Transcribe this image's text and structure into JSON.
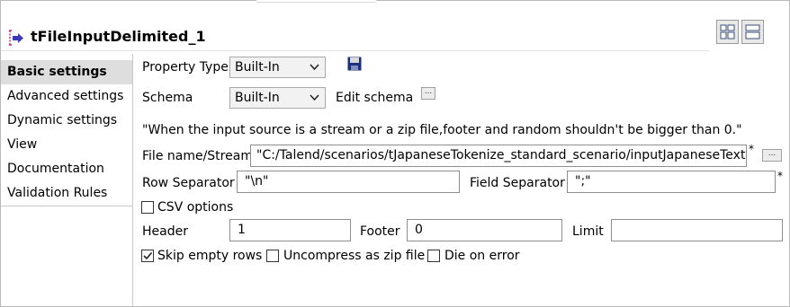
{
  "component": {
    "title": "tFileInputDelimited_1"
  },
  "sidebar": {
    "items": [
      {
        "label": "Basic settings",
        "active": true
      },
      {
        "label": "Advanced settings"
      },
      {
        "label": "Dynamic settings"
      },
      {
        "label": "View"
      },
      {
        "label": "Documentation"
      },
      {
        "label": "Validation Rules"
      }
    ]
  },
  "form": {
    "property_type_label": "Property Type",
    "property_type_value": "Built-In",
    "schema_label": "Schema",
    "schema_value": "Built-In",
    "edit_schema_label": "Edit schema",
    "notice": "\"When the input source is a stream or a zip file,footer and random shouldn't be bigger than 0.\"",
    "file_label": "File name/Stream",
    "file_value": "\"C:/Talend/scenarios/tJapaneseTokenize_standard_scenario/inputJapaneseText.txt\"",
    "row_sep_label": "Row Separator",
    "row_sep_value": "\"\\n\"",
    "field_sep_label": "Field Separator",
    "field_sep_value": "\";\"",
    "required_mark": "*",
    "csv_label": "CSV options",
    "csv_checked": false,
    "header_label": "Header",
    "header_value": "1",
    "footer_label": "Footer",
    "footer_value": "0",
    "limit_label": "Limit",
    "limit_value": "",
    "skip_empty_label": "Skip empty rows",
    "skip_empty_checked": true,
    "uncompress_label": "Uncompress as zip file",
    "uncompress_checked": false,
    "die_label": "Die on error",
    "die_checked": false,
    "dots": "..."
  }
}
